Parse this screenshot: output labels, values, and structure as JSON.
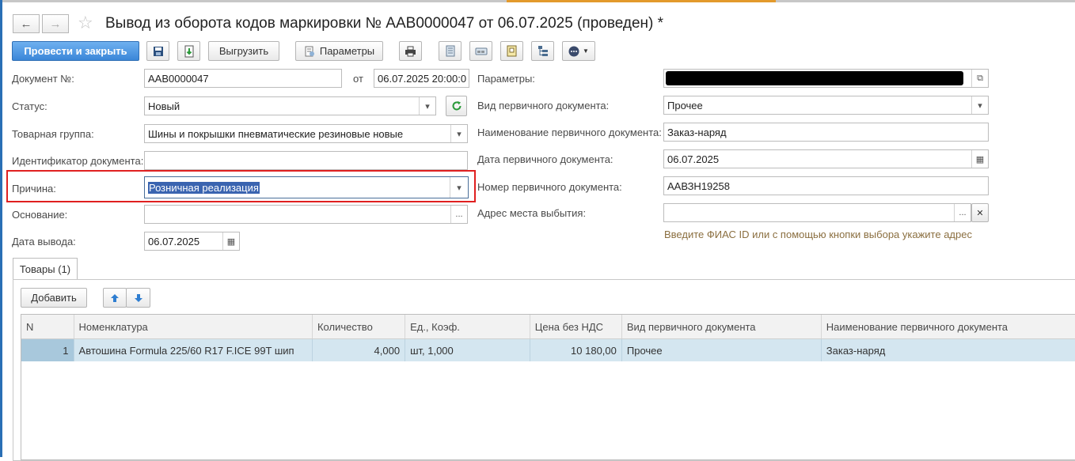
{
  "window": {
    "title": "Вывод из оборота кодов маркировки № ААВ0000047  от 06.07.2025 (проведен) *",
    "back_icon": "←",
    "forward_icon": "→",
    "star_icon": "☆"
  },
  "toolbar": {
    "post_close_label": "Провести и закрыть",
    "export_label": "Выгрузить",
    "params_label": "Параметры"
  },
  "form_left": {
    "doc_number_label": "Документ №:",
    "doc_number": "ААВ0000047",
    "from_label": "от",
    "doc_date": "06.07.2025 20:00:0",
    "status_label": "Статус:",
    "status": "Новый",
    "product_group_label": "Товарная группа:",
    "product_group": "Шины и покрышки пневматические резиновые новые",
    "doc_id_label": "Идентификатор документа:",
    "doc_id": "",
    "reason_label": "Причина:",
    "reason": "Розничная реализация",
    "basis_label": "Основание:",
    "basis": "",
    "withdrawal_date_label": "Дата вывода:",
    "withdrawal_date": "06.07.2025"
  },
  "form_right": {
    "params_label": "Параметры:",
    "primary_doc_type_label": "Вид первичного документа:",
    "primary_doc_type": "Прочее",
    "primary_doc_name_label": "Наименование первичного документа:",
    "primary_doc_name": "Заказ-наряд",
    "primary_doc_date_label": "Дата первичного документа:",
    "primary_doc_date": "06.07.2025",
    "primary_doc_number_label": "Номер первичного документа:",
    "primary_doc_number": "ААВЗН19258",
    "address_label": "Адрес места выбытия:",
    "address": "",
    "address_hint": "Введите ФИАС ID или с помощью кнопки выбора укажите адрес"
  },
  "tabs": [
    {
      "label": "Товары (1)"
    }
  ],
  "goods": {
    "add_label": "Добавить",
    "columns": [
      "N",
      "Номенклатура",
      "Количество",
      "Ед., Коэф.",
      "Цена без НДС",
      "Вид первичного документа",
      "Наименование первичного документа"
    ],
    "rows": [
      {
        "n": "1",
        "item": "Автошина Formula 225/60 R17 F.ICE 99T шип",
        "qty": "4,000",
        "unit": "шт, 1,000",
        "price": "10 180,00",
        "doc_type": "Прочее",
        "doc_name": "Заказ-наряд"
      }
    ]
  },
  "colors": {
    "accent": "#3a86d8",
    "highlight": "#e02020",
    "row_selected": "#d4e6f0",
    "top_orange": "#e39a2c"
  }
}
